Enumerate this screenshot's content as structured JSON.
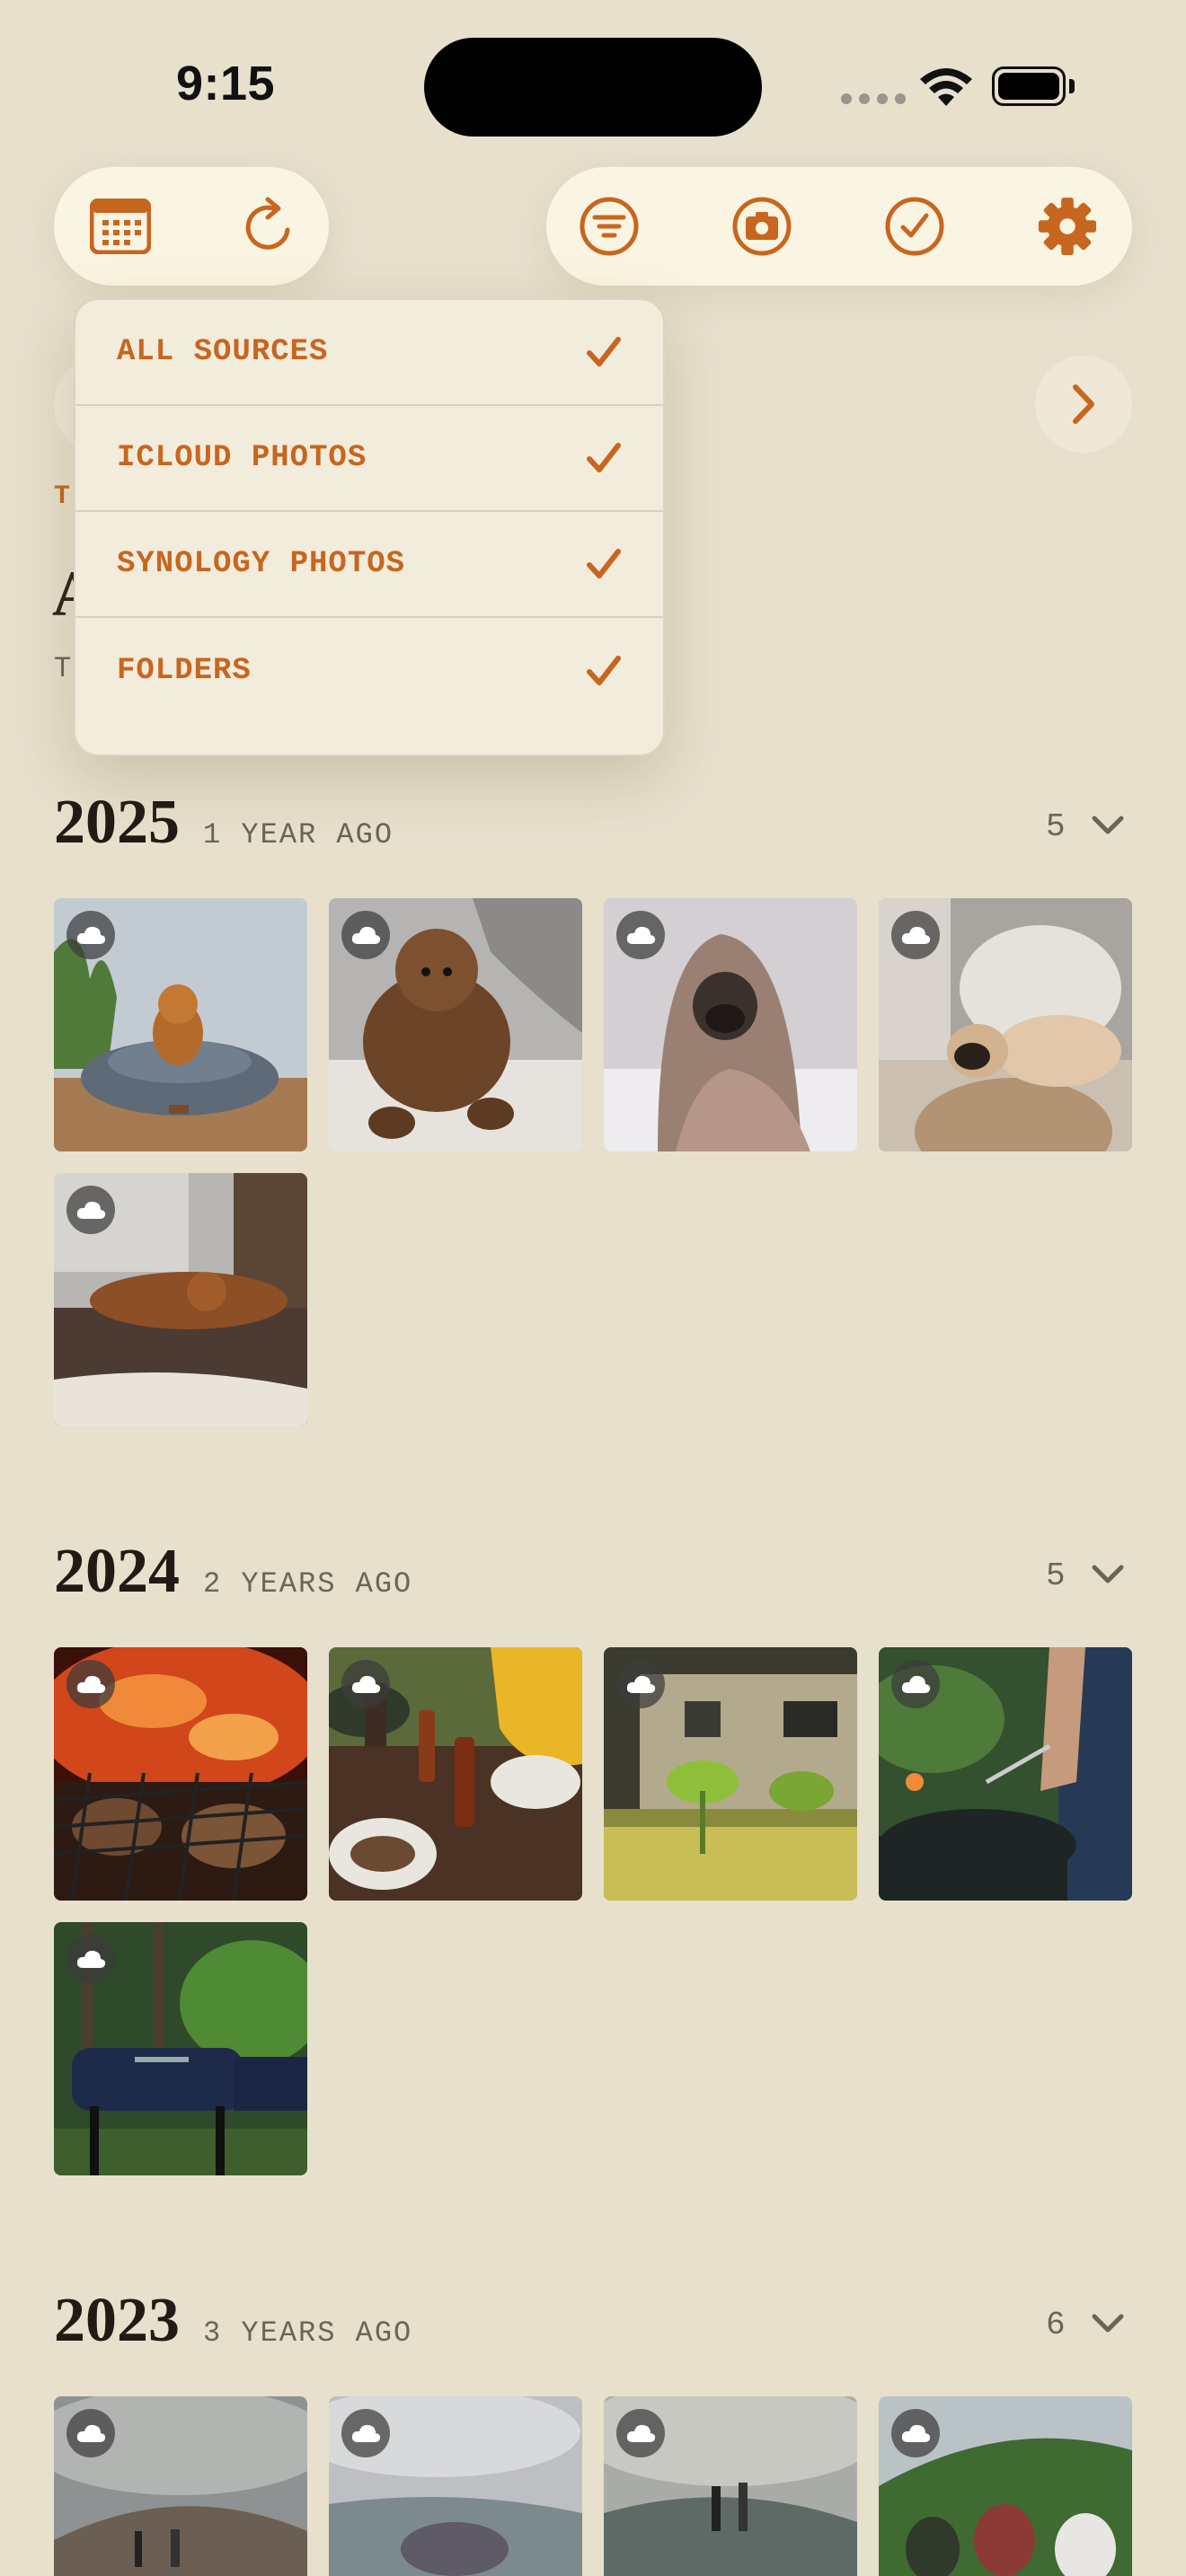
{
  "status_bar": {
    "time": "9:15"
  },
  "toolbar": {
    "left_icons": [
      "calendar-icon",
      "refresh-icon"
    ],
    "right_icons": [
      "filter-icon",
      "camera-icon",
      "checkmark-circle-icon",
      "gear-icon"
    ],
    "accent_color": "#c7661e"
  },
  "background": {
    "kicker": "T",
    "heading": "A",
    "subtitle": "T"
  },
  "dropdown": {
    "items": [
      {
        "label": "ALL SOURCES",
        "checked": true
      },
      {
        "label": "ICLOUD PHOTOS",
        "checked": true
      },
      {
        "label": "SYNOLOGY PHOTOS",
        "checked": true
      },
      {
        "label": "FOLDERS",
        "checked": true
      }
    ]
  },
  "years": [
    {
      "year": "2025",
      "ago": "1 YEAR AGO",
      "count": "5",
      "photos": [
        "dog in pet bed",
        "poodle on bed",
        "pug in blanket",
        "pug on couch",
        "golden retriever on bed"
      ]
    },
    {
      "year": "2024",
      "ago": "2 YEARS AGO",
      "count": "5",
      "photos": [
        "grill with meat over fire",
        "picnic table with drinks",
        "backyard with plants",
        "grilling outdoors",
        "blue smoker grill"
      ]
    },
    {
      "year": "2023",
      "ago": "3 YEARS AGO",
      "count": "6",
      "photos": [
        "hikers on mountain",
        "hikers at lookout",
        "hikers on ridge",
        "friends on hillside"
      ]
    }
  ]
}
